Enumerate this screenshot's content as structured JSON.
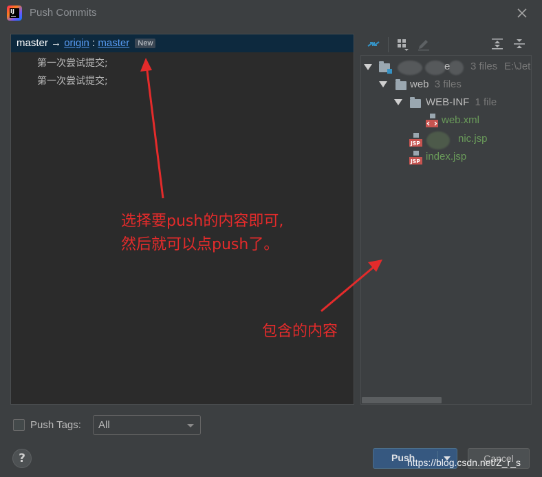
{
  "window": {
    "title": "Push Commits"
  },
  "left": {
    "branch": {
      "source": "master",
      "arrow": "→",
      "remote": "origin",
      "colon": ":",
      "target": "master",
      "badge": "New"
    },
    "commits": [
      "第一次尝试提交;",
      "第一次尝试提交;"
    ]
  },
  "tree": {
    "root": {
      "name_visible": "e",
      "count": "3 files",
      "path": "E:\\Jet"
    },
    "web": {
      "name": "web",
      "count": "3 files"
    },
    "webinf": {
      "name": "WEB-INF",
      "count": "1 file"
    },
    "files": [
      {
        "name": "web.xml",
        "icon": "xml-file-icon"
      },
      {
        "name": "nic.jsp",
        "icon": "jsp-file-icon"
      },
      {
        "name": "index.jsp",
        "icon": "jsp-file-icon"
      }
    ],
    "icon_labels": {
      "jsp": "JSP"
    }
  },
  "bottom": {
    "push_tags_label": "Push Tags:",
    "tags_select": "All",
    "help": "?",
    "push": "Push",
    "cancel": "Cancel"
  },
  "annotations": {
    "select_note_line1": "选择要push的内容即可,",
    "select_note_line2": "然后就可以点push了。",
    "contents_note": "包含的内容"
  },
  "watermark": "https://blog.csdn.net/Z_r_s",
  "colors": {
    "accent": "#365880",
    "annotation": "#e42b2b",
    "selected_row": "#0d293e",
    "link": "#589df6"
  }
}
